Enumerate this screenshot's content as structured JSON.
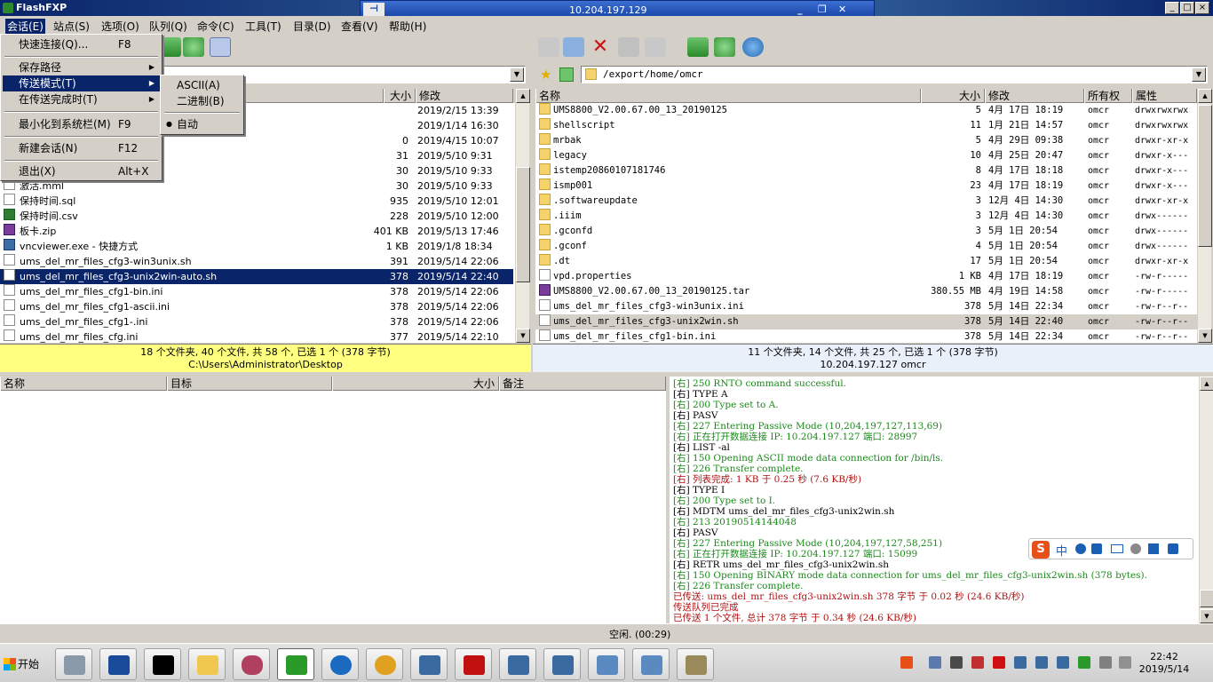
{
  "window": {
    "title": "FlashFXP",
    "min": "_",
    "max": "□",
    "close": "×"
  },
  "rdp": {
    "host": "10.204.197.129",
    "pin": "⊣",
    "min": "_",
    "restore": "❐",
    "close": "✕"
  },
  "menu": [
    "会话(E)",
    "站点(S)",
    "选项(O)",
    "队列(Q)",
    "命令(C)",
    "工具(T)",
    "目录(D)",
    "查看(V)",
    "帮助(H)"
  ],
  "session_menu": {
    "items": [
      {
        "label": "快速连接(Q)...",
        "shortcut": "F8"
      },
      {
        "label": "保存路径",
        "shortcut": "",
        "arrow": "▶"
      },
      {
        "label": "传送模式(T)",
        "shortcut": "",
        "arrow": "▶"
      },
      {
        "label": "在传送完成时(T)",
        "shortcut": "",
        "arrow": "▶"
      },
      {
        "label": "最小化到系统栏(M)",
        "shortcut": "F9"
      },
      {
        "label": "新建会话(N)",
        "shortcut": "F12"
      },
      {
        "label": "退出(X)",
        "shortcut": "Alt+X"
      }
    ]
  },
  "transfer_submenu": {
    "items": [
      "ASCII(A)",
      "二进制(B)",
      "自动"
    ],
    "bullet": "●"
  },
  "left": {
    "path": "C:\\Users\\Administrator\\Desktop",
    "headers": {
      "size": "大小",
      "modified": "修改"
    },
    "rows": [
      {
        "name": "",
        "size": "",
        "date": "2019/2/15 13:39",
        "icon": "file"
      },
      {
        "name": "",
        "size": "",
        "date": "2019/1/14 16:30",
        "icon": "file"
      },
      {
        "name": "",
        "size": "0",
        "date": "2019/4/15 10:07",
        "icon": "file"
      },
      {
        "name": "",
        "size": "31",
        "date": "2019/5/10 9:31",
        "icon": "file"
      },
      {
        "name": "",
        "size": "30",
        "date": "2019/5/10 9:33",
        "icon": "file"
      },
      {
        "name": "激活.mml",
        "size": "30",
        "date": "2019/5/10 9:33",
        "icon": "file"
      },
      {
        "name": "保持时间.sql",
        "size": "935",
        "date": "2019/5/10 12:01",
        "icon": "file"
      },
      {
        "name": "保持时间.csv",
        "size": "228",
        "date": "2019/5/10 12:00",
        "icon": "csv"
      },
      {
        "name": "板卡.zip",
        "size": "401 KB",
        "date": "2019/5/13 17:46",
        "icon": "zip"
      },
      {
        "name": "vncviewer.exe - 快捷方式",
        "size": "1 KB",
        "date": "2019/1/8 18:34",
        "icon": "exe"
      },
      {
        "name": "ums_del_mr_files_cfg3-win3unix.sh",
        "size": "391",
        "date": "2019/5/14 22:06",
        "icon": "file"
      },
      {
        "name": "ums_del_mr_files_cfg3-unix2win-auto.sh",
        "size": "378",
        "date": "2019/5/14 22:40",
        "icon": "file",
        "sel": true
      },
      {
        "name": "ums_del_mr_files_cfg1-bin.ini",
        "size": "378",
        "date": "2019/5/14 22:06",
        "icon": "file"
      },
      {
        "name": "ums_del_mr_files_cfg1-ascii.ini",
        "size": "378",
        "date": "2019/5/14 22:06",
        "icon": "file"
      },
      {
        "name": "ums_del_mr_files_cfg1-.ini",
        "size": "378",
        "date": "2019/5/14 22:06",
        "icon": "file"
      },
      {
        "name": "ums_del_mr_files_cfg.ini",
        "size": "377",
        "date": "2019/5/14 22:10",
        "icon": "file"
      }
    ],
    "status1": "18 个文件夹, 40 个文件, 共 58 个, 已选 1 个 (378 字节)",
    "status2": "C:\\Users\\Administrator\\Desktop"
  },
  "right": {
    "path": "/export/home/omcr",
    "headers": {
      "name": "名称",
      "size": "大小",
      "modified": "修改",
      "owner": "所有权",
      "attr": "属性"
    },
    "rows": [
      {
        "name": "UMS8800_V2.00.67.00_13_20190125",
        "size": "5",
        "date": "4月 17日 18:19",
        "owner": "omcr",
        "attr": "drwxrwxrwx",
        "icon": "folder"
      },
      {
        "name": "shellscript",
        "size": "11",
        "date": "1月 21日 14:57",
        "owner": "omcr",
        "attr": "drwxrwxrwx",
        "icon": "folder"
      },
      {
        "name": "mrbak",
        "size": "5",
        "date": "4月 29日 09:38",
        "owner": "omcr",
        "attr": "drwxr-xr-x",
        "icon": "folder"
      },
      {
        "name": "legacy",
        "size": "10",
        "date": "4月 25日 20:47",
        "owner": "omcr",
        "attr": "drwxr-x---",
        "icon": "folder"
      },
      {
        "name": "istemp20860107181746",
        "size": "8",
        "date": "4月 17日 18:18",
        "owner": "omcr",
        "attr": "drwxr-x---",
        "icon": "folder"
      },
      {
        "name": "ismp001",
        "size": "23",
        "date": "4月 17日 18:19",
        "owner": "omcr",
        "attr": "drwxr-x---",
        "icon": "folder"
      },
      {
        "name": ".softwareupdate",
        "size": "3",
        "date": "12月 4日 14:30",
        "owner": "omcr",
        "attr": "drwxr-xr-x",
        "icon": "folder"
      },
      {
        "name": ".iiim",
        "size": "3",
        "date": "12月 4日 14:30",
        "owner": "omcr",
        "attr": "drwx------",
        "icon": "folder"
      },
      {
        "name": ".gconfd",
        "size": "3",
        "date": "5月 1日 20:54",
        "owner": "omcr",
        "attr": "drwx------",
        "icon": "folder"
      },
      {
        "name": ".gconf",
        "size": "4",
        "date": "5月 1日 20:54",
        "owner": "omcr",
        "attr": "drwx------",
        "icon": "folder"
      },
      {
        "name": ".dt",
        "size": "17",
        "date": "5月 1日 20:54",
        "owner": "omcr",
        "attr": "drwxr-xr-x",
        "icon": "folder"
      },
      {
        "name": "vpd.properties",
        "size": "1 KB",
        "date": "4月 17日 18:19",
        "owner": "omcr",
        "attr": "-rw-r-----",
        "icon": "file"
      },
      {
        "name": "UMS8800_V2.00.67.00_13_20190125.tar",
        "size": "380.55 MB",
        "date": "4月 19日 14:58",
        "owner": "omcr",
        "attr": "-rw-r-----",
        "icon": "zip"
      },
      {
        "name": "ums_del_mr_files_cfg3-win3unix.ini",
        "size": "378",
        "date": "5月 14日 22:34",
        "owner": "omcr",
        "attr": "-rw-r--r--",
        "icon": "file"
      },
      {
        "name": "ums_del_mr_files_cfg3-unix2win.sh",
        "size": "378",
        "date": "5月 14日 22:40",
        "owner": "omcr",
        "attr": "-rw-r--r--",
        "icon": "file",
        "hl": true
      },
      {
        "name": "ums_del_mr_files_cfg1-bin.ini",
        "size": "378",
        "date": "5月 14日 22:34",
        "owner": "omcr",
        "attr": "-rw-r--r--",
        "icon": "file"
      }
    ],
    "status1": "11 个文件夹, 14 个文件, 共 25 个, 已选 1 个 (378 字节)",
    "status2": "10.204.197.127 omcr"
  },
  "queue": {
    "headers": [
      "名称",
      "目标",
      "大小",
      "备注"
    ]
  },
  "log": [
    {
      "t": "[右] 250 RNTO command successful.",
      "c": "g"
    },
    {
      "t": "[右] TYPE A",
      "c": "k"
    },
    {
      "t": "[右] 200 Type set to A.",
      "c": "g"
    },
    {
      "t": "[右] PASV",
      "c": "k"
    },
    {
      "t": "[右] 227 Entering Passive Mode (10,204,197,127,113,69)",
      "c": "g"
    },
    {
      "t": "[右] 正在打开数据连接 IP: 10.204.197.127 端口: 28997",
      "c": "g"
    },
    {
      "t": "[右] LIST -al",
      "c": "k"
    },
    {
      "t": "[右] 150 Opening ASCII mode data connection for /bin/ls.",
      "c": "g"
    },
    {
      "t": "[右] 226 Transfer complete.",
      "c": "g"
    },
    {
      "t": "[右] 列表完成: 1 KB 于 0.25 秒 (7.6 KB/秒)",
      "c": "r"
    },
    {
      "t": "[右] TYPE I",
      "c": "k"
    },
    {
      "t": "[右] 200 Type set to I.",
      "c": "g"
    },
    {
      "t": "[右] MDTM ums_del_mr_files_cfg3-unix2win.sh",
      "c": "k"
    },
    {
      "t": "[右] 213 20190514144048",
      "c": "g"
    },
    {
      "t": "[右] PASV",
      "c": "k"
    },
    {
      "t": "[右] 227 Entering Passive Mode (10,204,197,127,58,251)",
      "c": "g"
    },
    {
      "t": "[右] 正在打开数据连接 IP: 10.204.197.127 端口: 15099",
      "c": "g"
    },
    {
      "t": "[右] RETR ums_del_mr_files_cfg3-unix2win.sh",
      "c": "k"
    },
    {
      "t": "[右] 150 Opening BINARY mode data connection for ums_del_mr_files_cfg3-unix2win.sh (378 bytes).",
      "c": "g"
    },
    {
      "t": "[右] 226 Transfer complete.",
      "c": "g"
    },
    {
      "t": "已传送: ums_del_mr_files_cfg3-unix2win.sh 378 字节 于 0.02 秒 (24.6 KB/秒)",
      "c": "r"
    },
    {
      "t": "传送队列已完成",
      "c": "r"
    },
    {
      "t": "已传送 1 个文件, 总计 378 字节 于 0.34 秒 (24.6 KB/秒)",
      "c": "r"
    }
  ],
  "status_bar": "空闲. (00:29)",
  "taskbar": {
    "start": "开始",
    "time": "22:42",
    "date": "2019/5/14"
  },
  "ime": {
    "label": "中"
  }
}
